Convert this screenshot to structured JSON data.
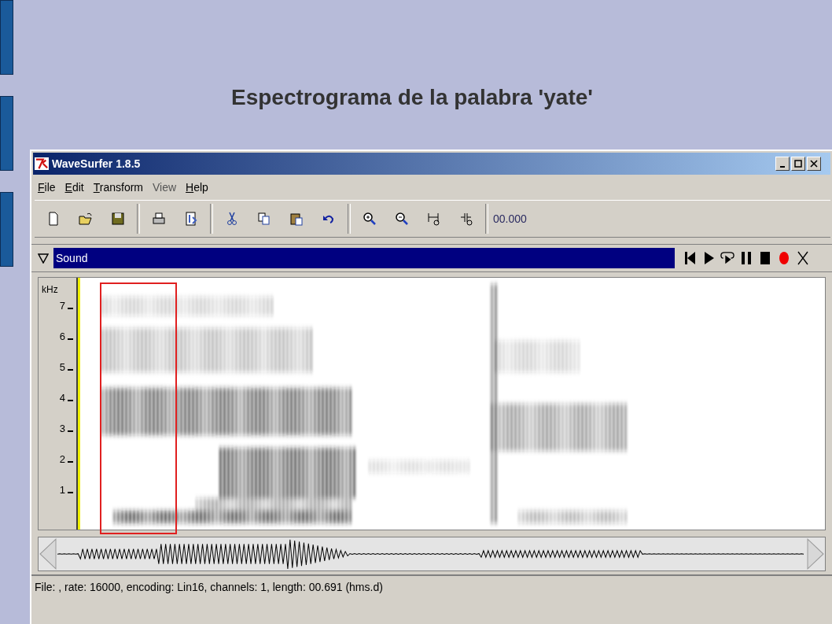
{
  "slide": {
    "title": "Espectrograma de la palabra 'yate'"
  },
  "window": {
    "title": "WaveSurfer 1.8.5"
  },
  "menu": [
    {
      "label": "File",
      "underlined": true
    },
    {
      "label": "Edit",
      "underlined": true
    },
    {
      "label": "Transform",
      "underlined": true
    },
    {
      "label": "View",
      "underlined": false
    },
    {
      "label": "Help",
      "underlined": true
    }
  ],
  "toolbar": {
    "time": "00.000"
  },
  "sound_pane": {
    "title": "Sound"
  },
  "spectrogram": {
    "unit": "kHz",
    "ticks": [
      "7",
      "6",
      "5",
      "4",
      "3",
      "2",
      "1"
    ]
  },
  "status_bar": "File: , rate: 16000, encoding: Lin16, channels: 1, length: 00.691 (hms.d)"
}
